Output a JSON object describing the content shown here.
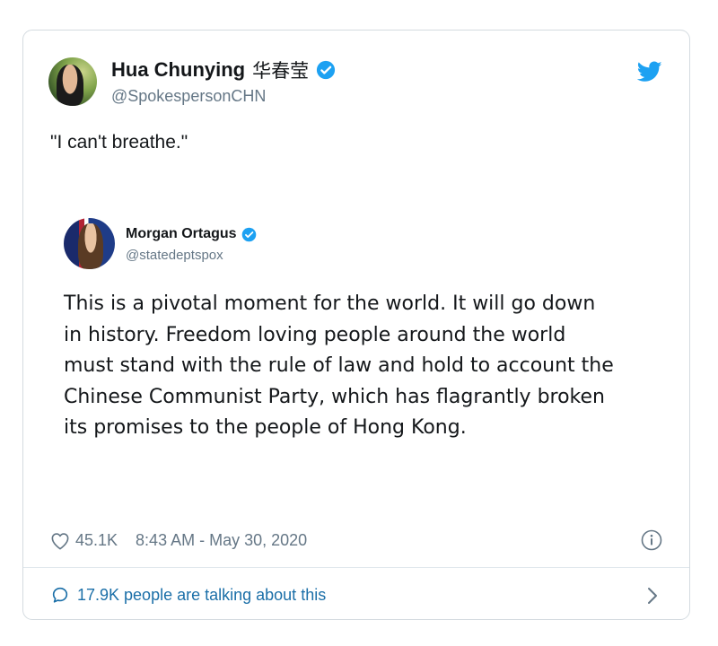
{
  "tweet": {
    "author": {
      "name": "Hua Chunying",
      "name_cjk": "华春莹",
      "handle": "@SpokespersonCHN",
      "verified": true
    },
    "text": "\"I can't breathe.\"",
    "quoted": {
      "name": "Morgan Ortagus",
      "handle": "@statedeptspox",
      "verified": true,
      "lines": [
        "This is a pivotal moment for the world. It will go down",
        "in history. Freedom loving people around the world",
        "must stand with the rule of law and hold to account the",
        "Chinese Communist Party, which has flagrantly broken",
        "its promises to the people of Hong Kong."
      ]
    },
    "likes": "45.1K",
    "timestamp": "8:43 AM - May 30, 2020",
    "talking": "17.9K people are talking about this"
  },
  "icons": {
    "brand": "twitter-bird-icon",
    "verified": "verified-badge-icon",
    "like": "heart-icon",
    "info": "info-icon",
    "reply": "speech-bubble-icon",
    "chevron": "chevron-right-icon"
  },
  "colors": {
    "twitter_blue": "#1da1f2",
    "link_blue": "#1b6fa8",
    "secondary_text": "#657786",
    "border": "#d4dbe0"
  }
}
